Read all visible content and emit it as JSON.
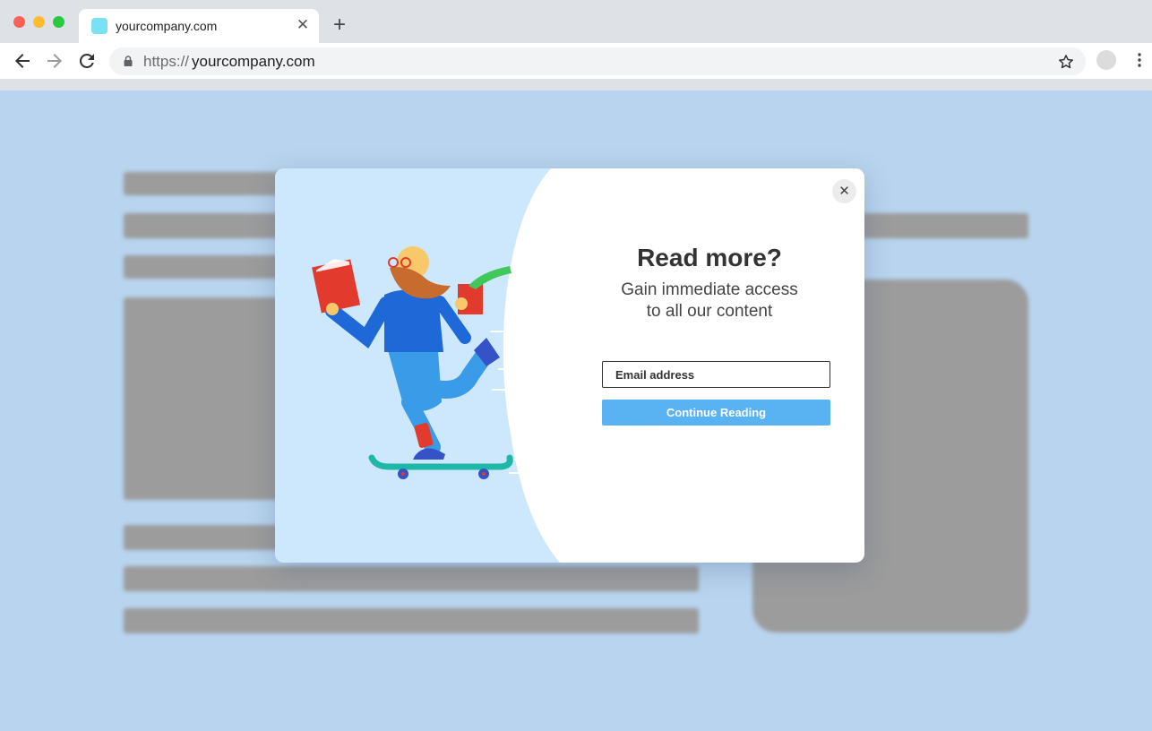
{
  "browser": {
    "tab": {
      "title": "yourcompany.com",
      "close_symbol": "✕"
    },
    "new_tab_symbol": "+",
    "address_bar": {
      "scheme": "https://",
      "host": "yourcompany.com"
    },
    "icons": [
      "back-arrow-icon",
      "forward-arrow-icon",
      "reload-icon",
      "lock-icon",
      "star-icon",
      "kebab-menu-icon"
    ]
  },
  "modal": {
    "title": "Read more?",
    "subtitle_line1": "Gain immediate access",
    "subtitle_line2": "to all our content",
    "email_placeholder": "Email address",
    "submit_label": "Continue Reading",
    "close_symbol": "✕"
  },
  "colors": {
    "page_background": "#b8d4ee",
    "illustration_background": "#cde8fc",
    "button": "#59b2f2"
  }
}
